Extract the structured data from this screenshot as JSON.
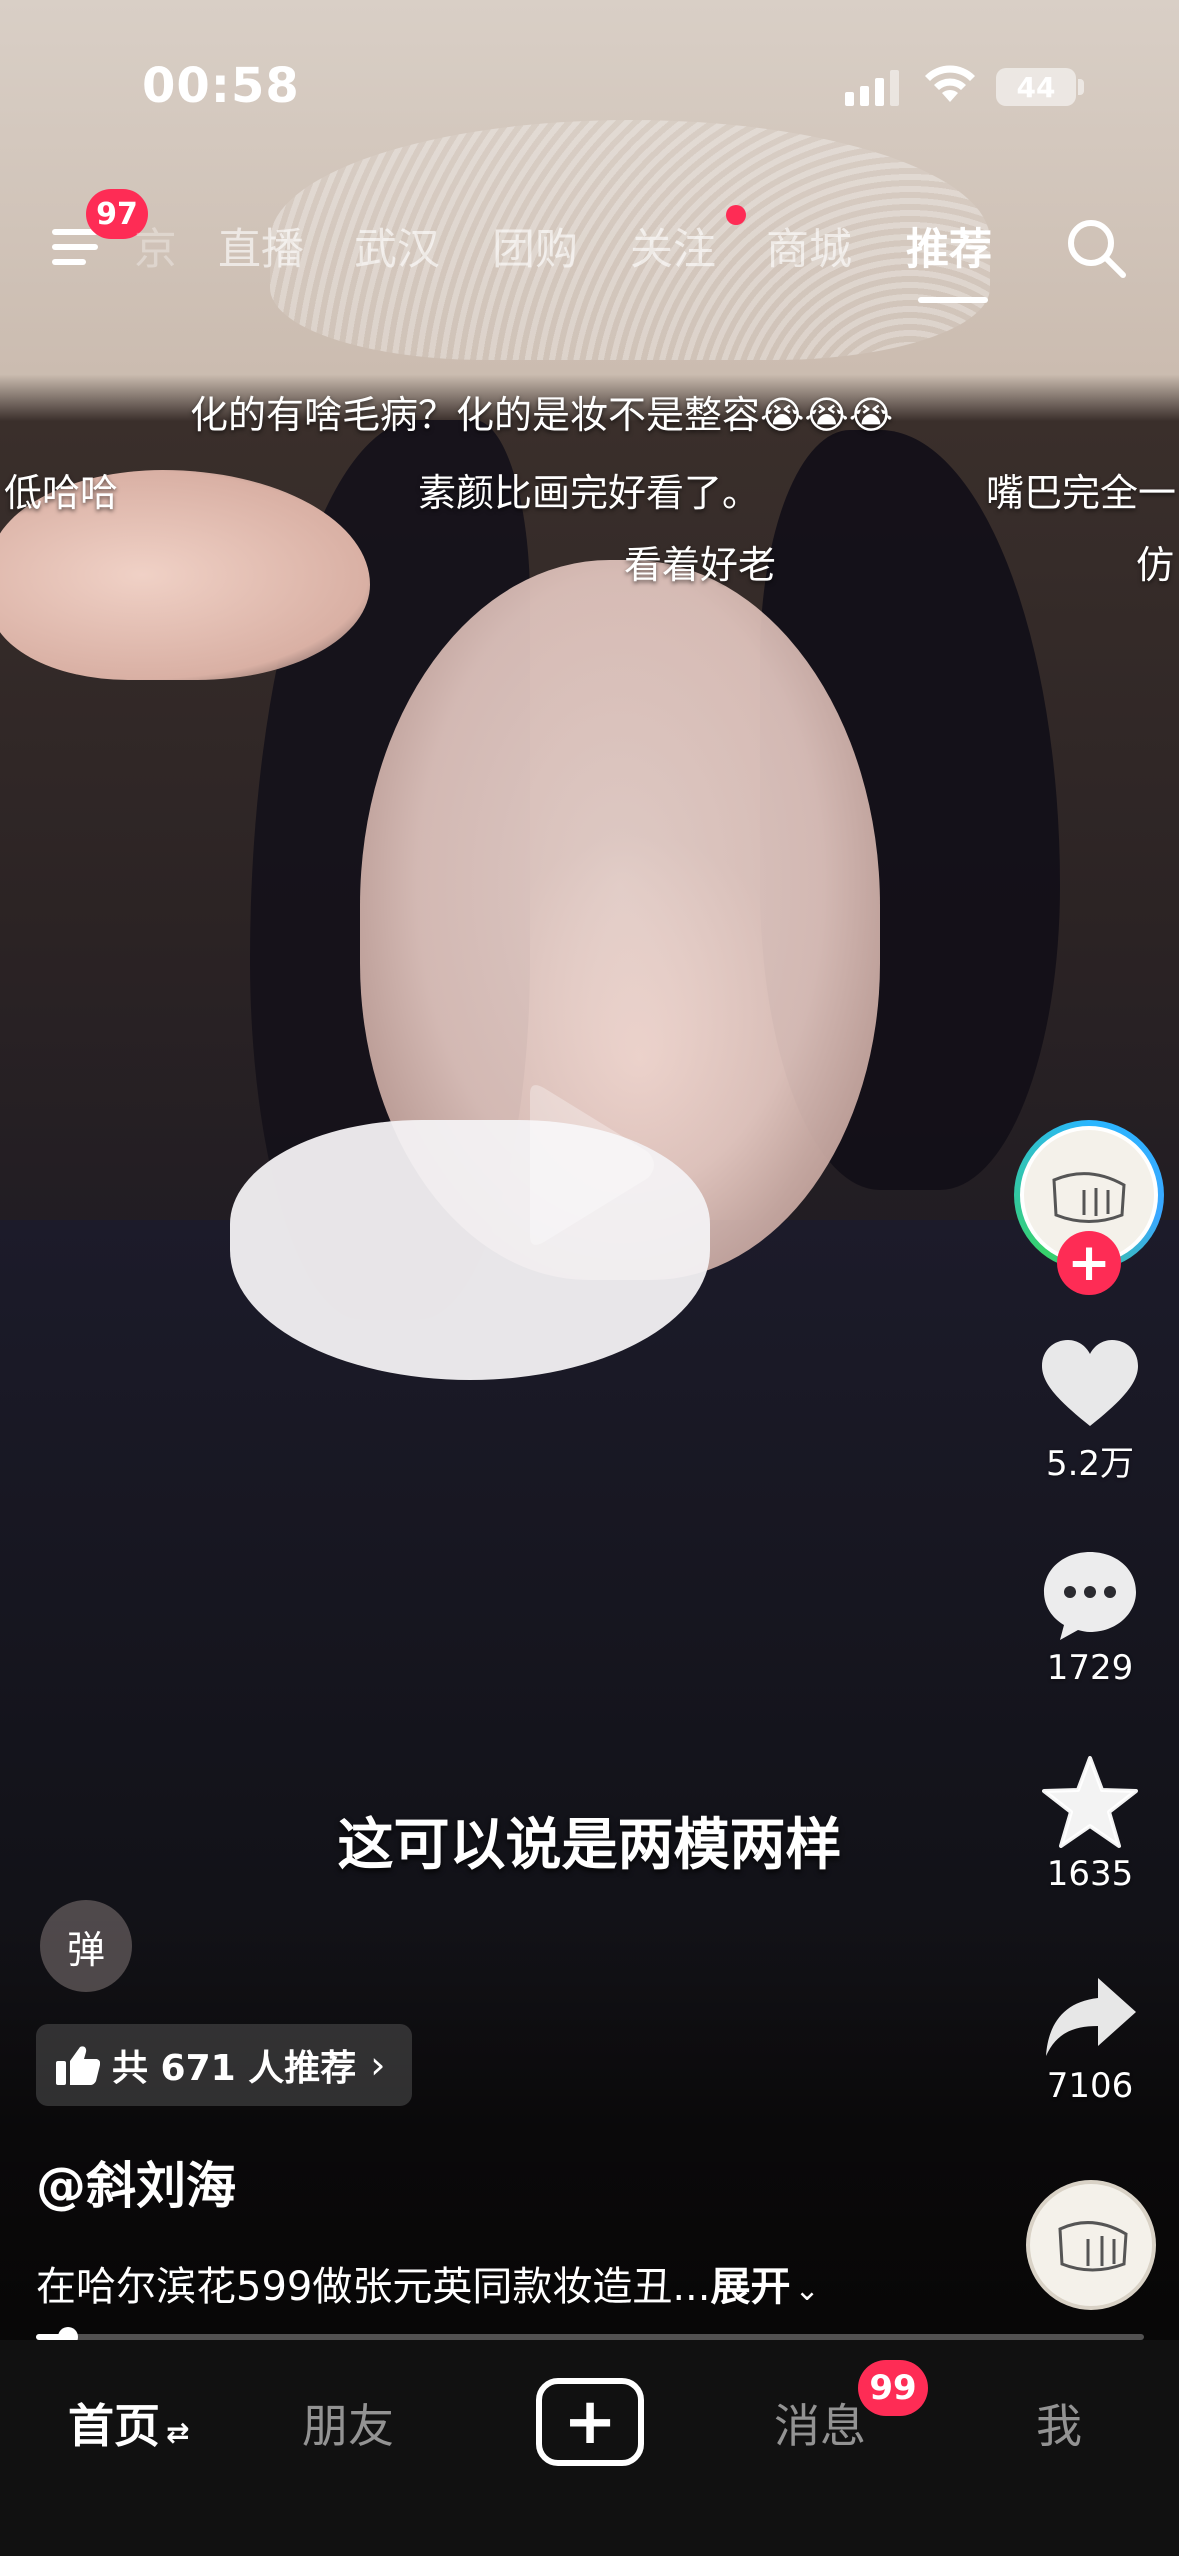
{
  "status_bar": {
    "time": "00:58",
    "battery": "44"
  },
  "top_nav": {
    "menu_badge": "97",
    "tabs": [
      {
        "label": "京"
      },
      {
        "label": "直播"
      },
      {
        "label": "武汉"
      },
      {
        "label": "团购"
      },
      {
        "label": "关注"
      },
      {
        "label": "商城"
      },
      {
        "label": "推荐"
      }
    ],
    "active_tab": "推荐"
  },
  "danmaku": [
    "化的有啥毛病？化的是妆不是整容😭😭😭",
    "低哈哈",
    "素颜比画完好看了。",
    "嘴巴完全一",
    "看着好老",
    "仿"
  ],
  "subtitle": "这可以说是两模两样",
  "actions": {
    "likes": "5.2万",
    "comments": "1729",
    "favorites": "1635",
    "shares": "7106"
  },
  "danmu_toggle": "弹",
  "recommend": {
    "text": "共 671 人推荐",
    "chevron": "›"
  },
  "author": "@斜刘海",
  "description": {
    "text": "在哈尔滨花599做张元英同款妆造丑...",
    "expand": "展开"
  },
  "progress": 0.025,
  "tab_bar": {
    "home": "首页",
    "friends": "朋友",
    "messages": "消息",
    "messages_badge": "99",
    "me": "我"
  }
}
